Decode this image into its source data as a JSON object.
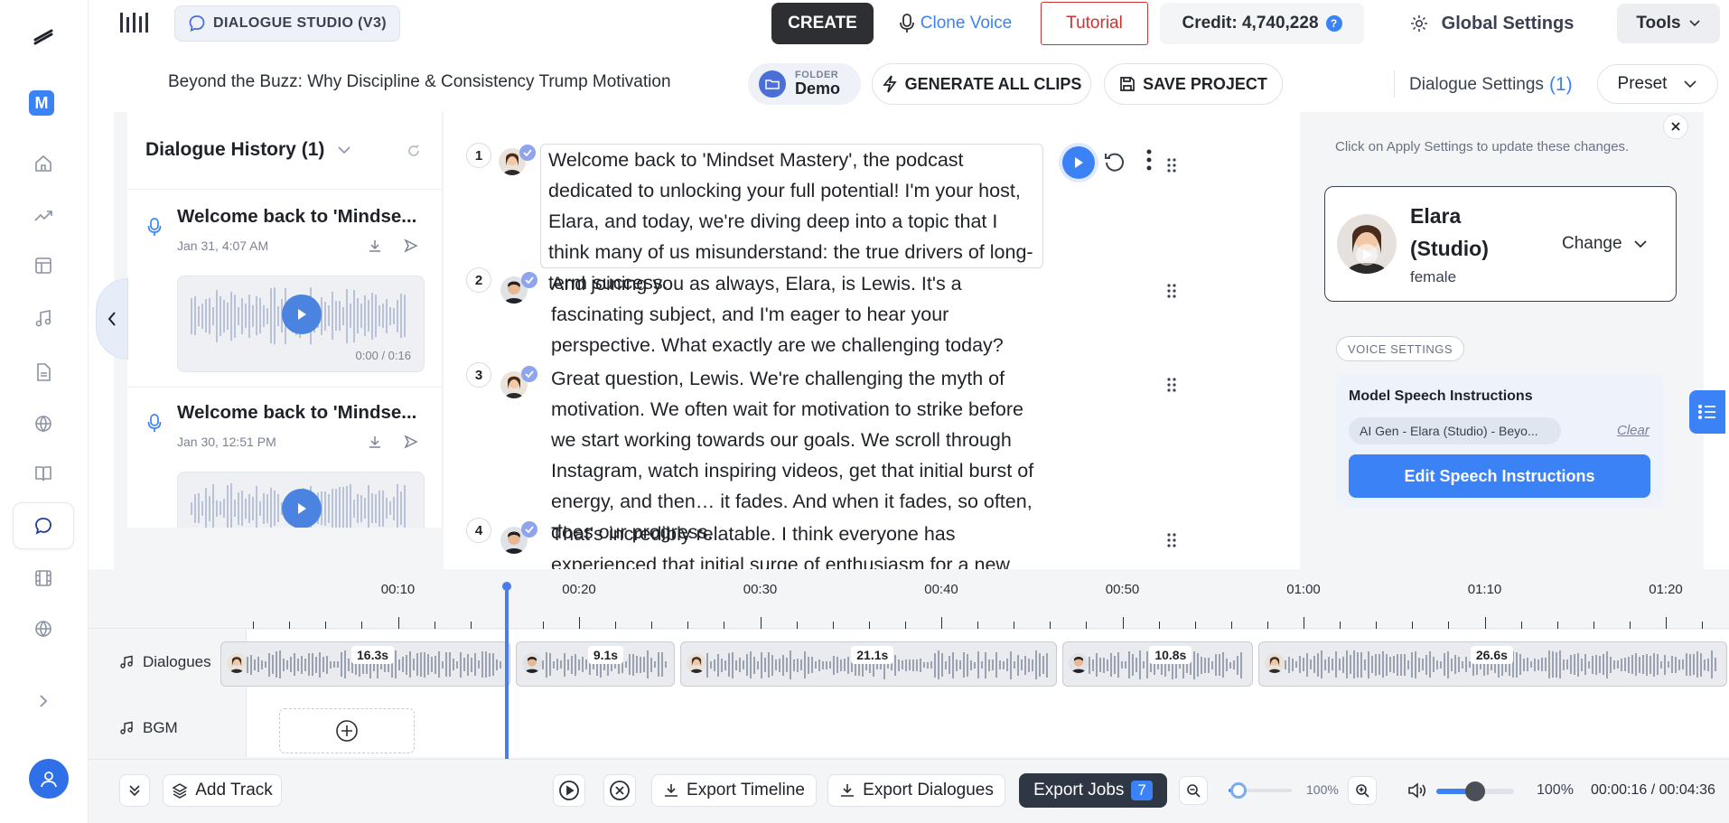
{
  "app": {
    "name": "DIALOGUE STUDIO (V3)"
  },
  "rail": {
    "avatar_letter": "M"
  },
  "header": {
    "create_label": "CREATE",
    "clone_voice_label": "Clone Voice",
    "tutorial_label": "Tutorial",
    "credit_label": "Credit: 4,740,228",
    "help_label": "?",
    "global_settings_label": "Global Settings",
    "tools_label": "Tools"
  },
  "project": {
    "title": "Beyond the Buzz: Why Discipline & Consistency Trump Motivation",
    "folder_caption": "FOLDER",
    "folder_name": "Demo",
    "generate_label": "GENERATE ALL CLIPS",
    "save_label": "SAVE PROJECT"
  },
  "settings_header": {
    "label": "Dialogue Settings",
    "count": "(1)",
    "preset_label": "Preset"
  },
  "history": {
    "title": "Dialogue History (1)",
    "items": [
      {
        "title": "Welcome back to 'Mindse...",
        "date": "Jan 31, 4:07 AM",
        "time": "0:00 / 0:16"
      },
      {
        "title": "Welcome back to 'Mindse...",
        "date": "Jan 30, 12:51 PM"
      }
    ]
  },
  "dialogue_lines": [
    {
      "num": "1",
      "speaker": "Elara",
      "text": "Welcome back to 'Mindset Mastery', the podcast dedicated to unlocking your full potential! I'm your host, Elara, and today, we're diving deep into a topic that I think many of us misunderstand: the true drivers of long-term success."
    },
    {
      "num": "2",
      "speaker": "Lewis",
      "text": "And joining you as always, Elara, is Lewis. It's a fascinating subject, and I'm eager to hear your perspective. What exactly are we challenging today?"
    },
    {
      "num": "3",
      "speaker": "Elara",
      "text": "Great question, Lewis. We're challenging the myth of motivation. We often wait for motivation to strike before we start working towards our goals. We scroll through Instagram, watch inspiring videos, get that initial burst of energy, and then… it fades. And when it fades, so often, does our progress."
    },
    {
      "num": "4",
      "speaker": "Lewis",
      "text": "That's incredibly relatable. I think everyone has experienced that initial surge of enthusiasm for a new project or a fitness"
    }
  ],
  "voice_panel": {
    "notice": "Click on Apply Settings to update these changes.",
    "voice_name": "Elara (Studio)",
    "voice_gender": "female",
    "change_label": "Change",
    "voice_settings_tag": "VOICE SETTINGS",
    "model_speech_title": "Model Speech Instructions",
    "instruction_chip": "AI Gen - Elara (Studio) - Beyo...",
    "clear_label": "Clear",
    "edit_button_label": "Edit Speech Instructions"
  },
  "timeline": {
    "ticks": [
      {
        "label": "00:10",
        "value": 10
      },
      {
        "label": "00:20",
        "value": 20
      },
      {
        "label": "00:30",
        "value": 30
      },
      {
        "label": "00:40",
        "value": 40
      },
      {
        "label": "00:50",
        "value": 50
      },
      {
        "label": "01:00",
        "value": 60
      },
      {
        "label": "01:10",
        "value": 70
      },
      {
        "label": "01:20",
        "value": 80
      }
    ],
    "playhead_seconds": 16,
    "tracks": {
      "dialogues_label": "Dialogues",
      "bgm_label": "BGM"
    },
    "clips": [
      {
        "length_label": "16.3s",
        "start": 0,
        "duration": 16.3,
        "speaker": "Elara"
      },
      {
        "length_label": "9.1s",
        "start": 16.3,
        "duration": 9.1,
        "speaker": "Lewis"
      },
      {
        "length_label": "21.1s",
        "start": 25.4,
        "duration": 21.1,
        "speaker": "Elara"
      },
      {
        "length_label": "10.8s",
        "start": 46.5,
        "duration": 10.8,
        "speaker": "Lewis"
      },
      {
        "length_label": "26.6s",
        "start": 57.3,
        "duration": 26.6,
        "speaker": "Elara"
      }
    ]
  },
  "bottom_bar": {
    "add_track_label": "Add Track",
    "export_timeline_label": "Export Timeline",
    "export_dialogues_label": "Export Dialogues",
    "export_jobs_label": "Export Jobs",
    "export_jobs_count": "7",
    "zoom_label": "100%",
    "zoom_fraction": 0.15,
    "volume_label": "100%",
    "volume_fraction": 0.5,
    "time_label": "00:00:16 / 00:04:36"
  },
  "colors": {
    "accent": "#3b82f6",
    "dark": "#2d2f33",
    "tutorial_red": "#d23131",
    "track_blue": "#4a7de8"
  }
}
